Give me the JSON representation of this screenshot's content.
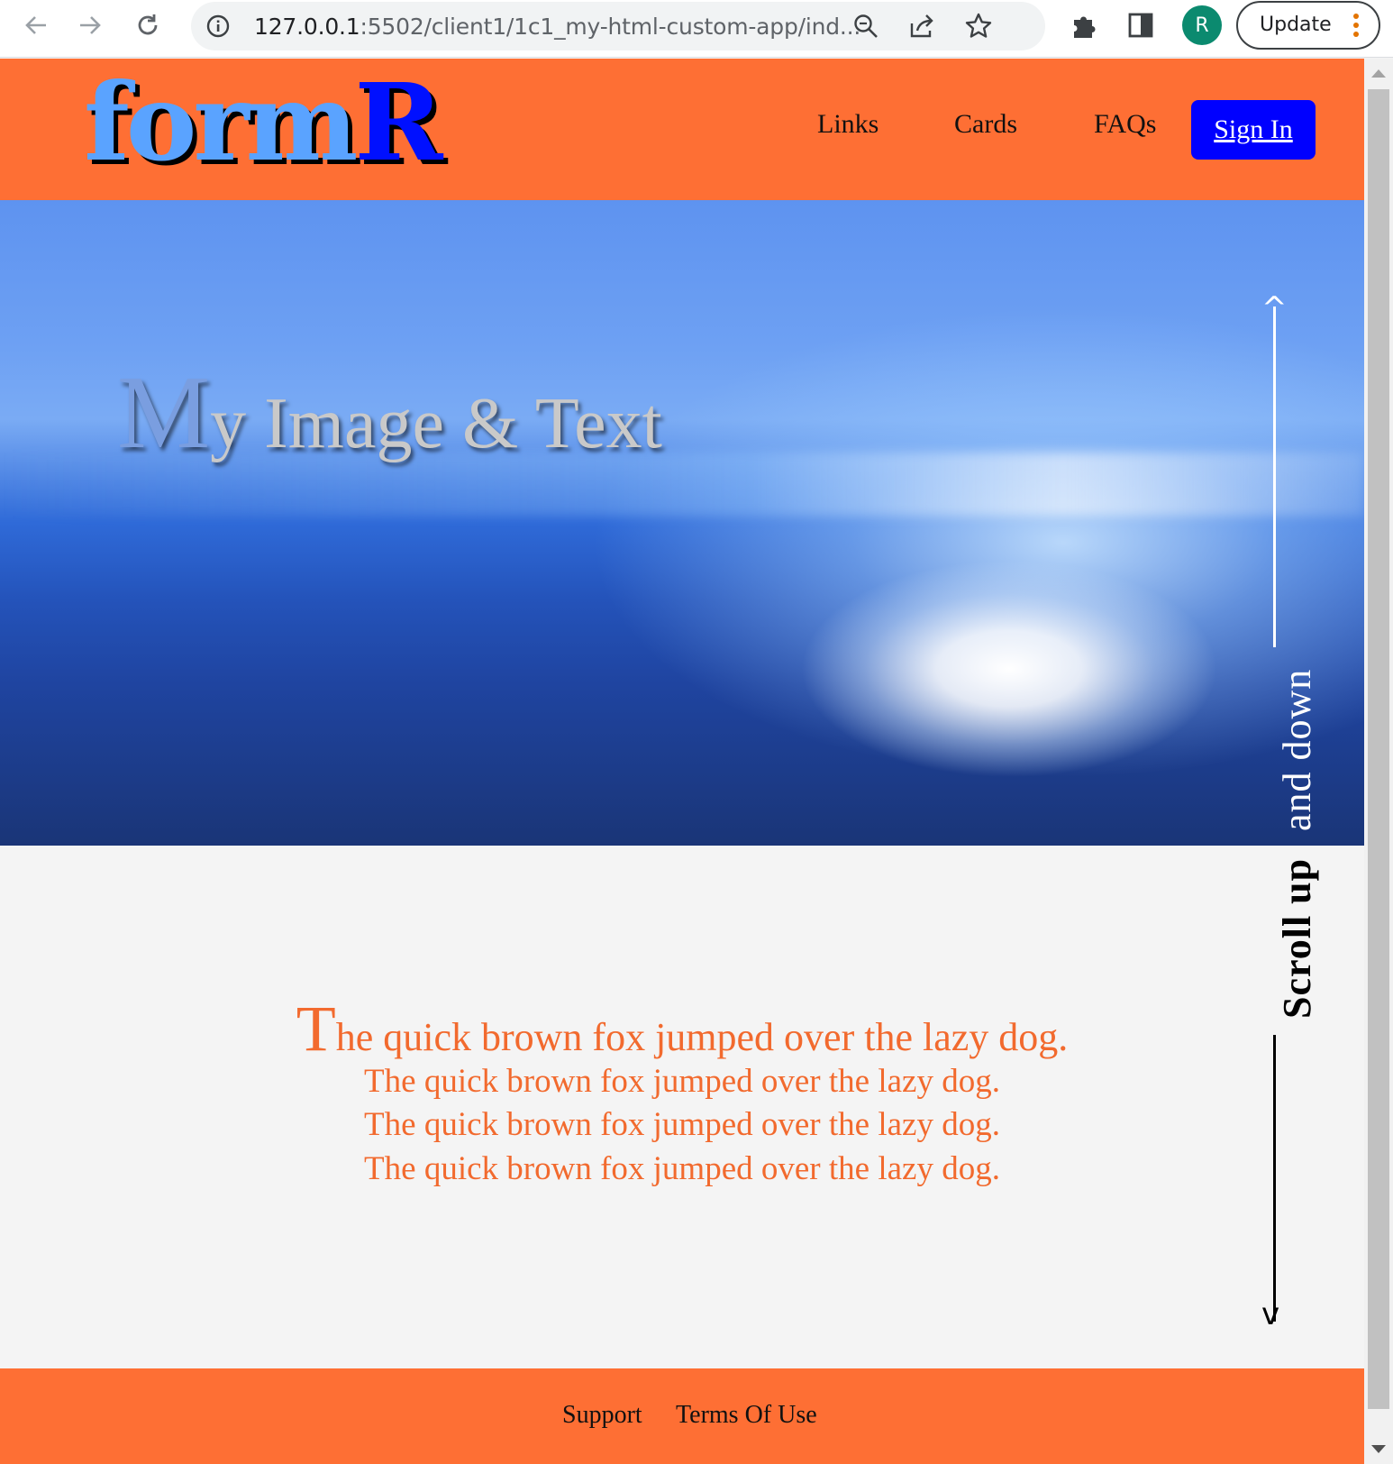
{
  "browser": {
    "url_host": "127.0.0.1",
    "url_path": ":5502/client1/1c1_my-html-custom-app/ind...",
    "profile_initial": "R",
    "update_label": "Update"
  },
  "header": {
    "logo_part1": "form",
    "logo_part2": "R",
    "nav": [
      "Links",
      "Cards",
      "FAQs"
    ],
    "signin_label": "Sign In"
  },
  "hero": {
    "title_first": "M",
    "title_rest": "y Image & Text"
  },
  "main": {
    "line1_dropcap": "T",
    "line1_rest": "he quick brown fox jumped over the lazy dog.",
    "lines": [
      "The quick brown fox jumped over the lazy dog.",
      "The quick brown fox jumped over the lazy dog.",
      "The quick brown fox jumped over the lazy dog."
    ]
  },
  "scroll_indicator": {
    "part1": "and down",
    "part2": "Scroll up",
    "arrow_up": "^",
    "arrow_down": "v"
  },
  "footer": {
    "links": [
      "Support",
      "Terms Of Use"
    ]
  },
  "colors": {
    "brand_orange": "#fe6f34",
    "signin_blue": "#0000ff",
    "text_orange": "#f26a2e"
  }
}
